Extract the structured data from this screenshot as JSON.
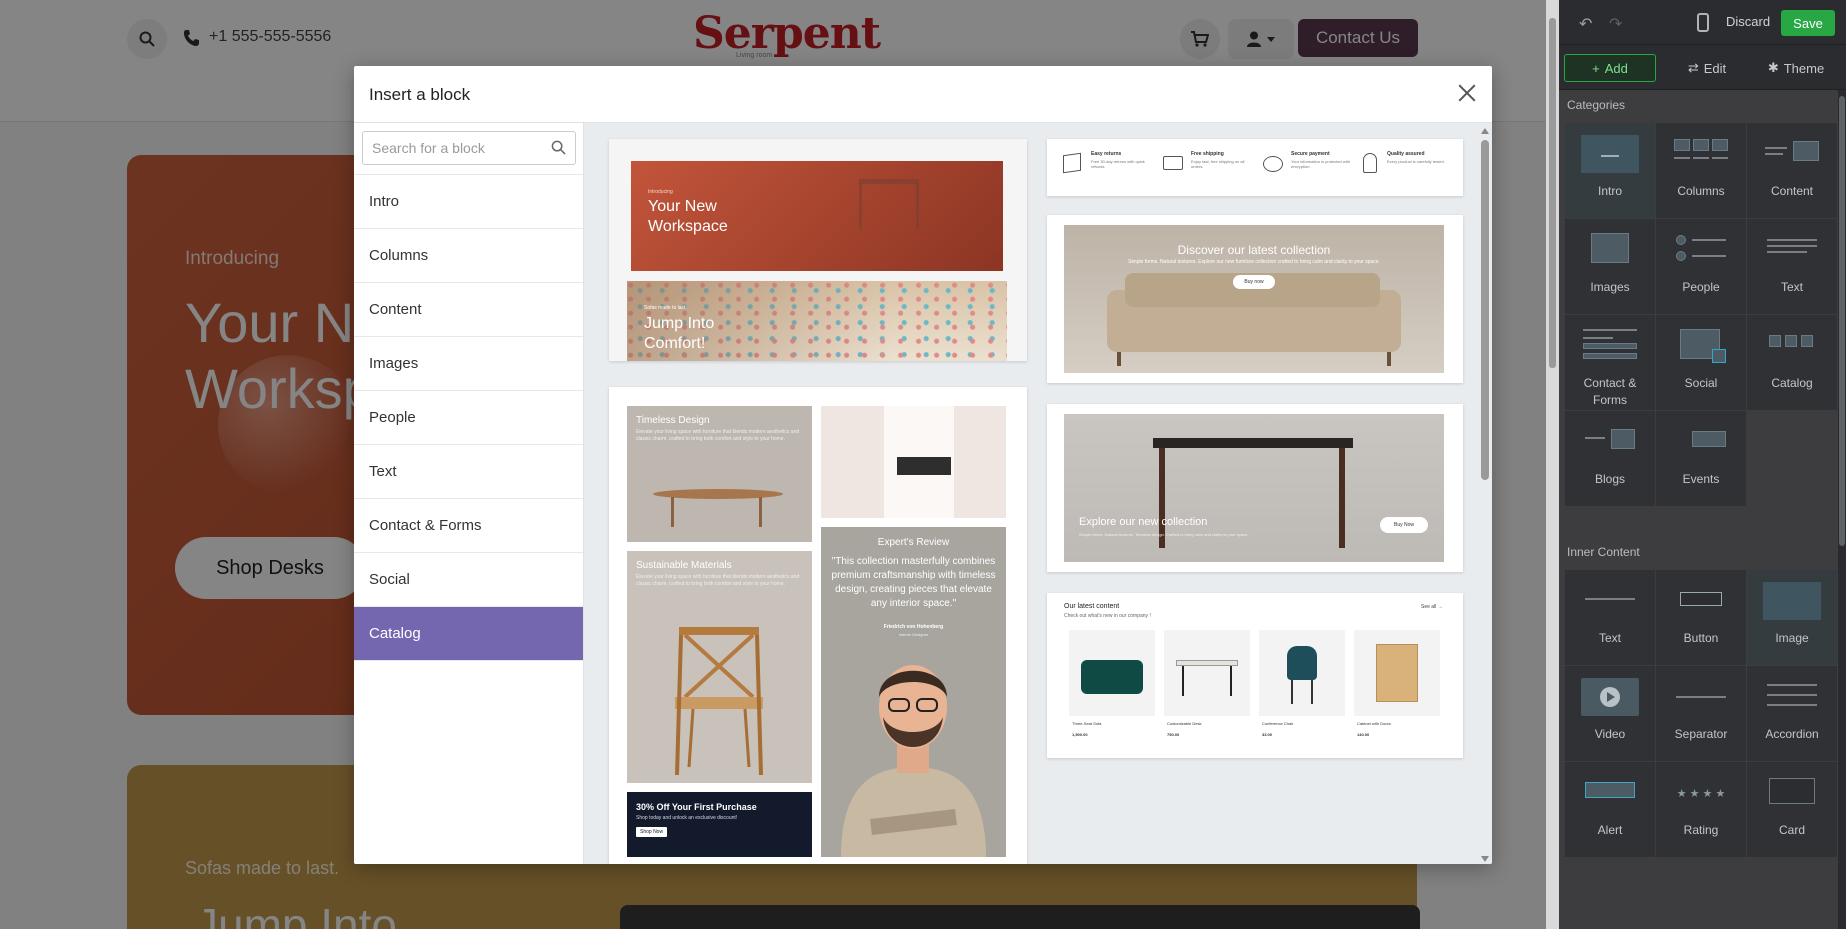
{
  "site": {
    "phone": "+1 555-555-5556",
    "logo": "Serpent",
    "logo_sub": "Living room",
    "contact_label": "Contact Us",
    "hero1": {
      "intro": "Introducing",
      "title_l1": "Your Ne",
      "title_l2": "Worksp",
      "button": "Shop Desks"
    },
    "hero2": {
      "intro": "Sofas made to last.",
      "title": "Jump Into"
    }
  },
  "panel": {
    "discard": "Discard",
    "save": "Save",
    "tabs": {
      "add": "Add",
      "edit": "Edit",
      "theme": "Theme"
    },
    "categories_title": "Categories",
    "categories": [
      {
        "label": "Intro"
      },
      {
        "label": "Columns"
      },
      {
        "label": "Content"
      },
      {
        "label": "Images"
      },
      {
        "label": "People"
      },
      {
        "label": "Text"
      },
      {
        "label": "Contact & Forms"
      },
      {
        "label": "Social"
      },
      {
        "label": "Catalog"
      },
      {
        "label": "Blogs"
      },
      {
        "label": "Events"
      }
    ],
    "inner_title": "Inner Content",
    "inner": [
      {
        "label": "Text"
      },
      {
        "label": "Button"
      },
      {
        "label": "Image"
      },
      {
        "label": "Video"
      },
      {
        "label": "Separator"
      },
      {
        "label": "Accordion"
      },
      {
        "label": "Alert"
      },
      {
        "label": "Rating"
      },
      {
        "label": "Card"
      }
    ]
  },
  "modal": {
    "title": "Insert a block",
    "search_placeholder": "Search for a block",
    "categories": [
      "Intro",
      "Columns",
      "Content",
      "Images",
      "People",
      "Text",
      "Contact & Forms",
      "Social",
      "Catalog"
    ],
    "active_category": "Catalog",
    "previews": {
      "workspace_tag": "Introducing",
      "workspace_title": "Your New Workspace",
      "comfort_tag": "Sofas made to last.",
      "comfort_title": "Jump Into Comfort!",
      "features": [
        {
          "title": "Easy returns",
          "text": "Free 30-day returns with quick refunds."
        },
        {
          "title": "Free shipping",
          "text": "Enjoy fast, free shipping on all orders."
        },
        {
          "title": "Secure payment",
          "text": "Your information is protected with encryption."
        },
        {
          "title": "Quality assured",
          "text": "Every product is carefully tested."
        }
      ],
      "discover_title": "Discover our latest collection",
      "discover_text": "Simple forms. Natural textures. Explore our new furniture collection crafted to bring calm and clarity to your space.",
      "discover_btn": "Buy now",
      "timeless_title": "Timeless Design",
      "timeless_text": "Elevate your living space with furniture that blends modern aesthetics and classic charm, crafted to bring both comfort and style to your home.",
      "sustainable_title": "Sustainable Materials",
      "sustainable_text": "Elevate your living space with furniture that blends modern aesthetics and classic charm, crafted to bring both comfort and style to your home.",
      "expert_title": "Expert's Review",
      "expert_quote": "\"This collection masterfully combines premium craftsmanship with timeless design, creating pieces that elevate any interior space.\"",
      "expert_name": "Friedrich von Hohenberg",
      "expert_role": "Interior Designer",
      "promo_title": "30% Off Your First Purchase",
      "promo_text": "Shop today and unlock an exclusive discount!",
      "promo_btn": "Shop Now",
      "explore_title": "Explore our new collection",
      "explore_text": "Simple forms. Natural textures. Timeless design. Crafted to bring calm and clarity to your space.",
      "explore_btn": "Buy Now",
      "latest_title": "Our latest content",
      "latest_sub": "Check out what's new in our company !",
      "see_all": "See all →",
      "products": [
        {
          "name": "Three-Seat Sofa",
          "price": "1,500.00"
        },
        {
          "name": "Customizable Desk",
          "price": "750.00"
        },
        {
          "name": "Conference Chair",
          "price": "33.00"
        },
        {
          "name": "Cabinet with Doors",
          "price": "140.00"
        }
      ]
    }
  },
  "colors": {
    "accent": "#7467b0",
    "save": "#28a745",
    "contact": "#5a3a4f",
    "logo": "#c42026"
  }
}
